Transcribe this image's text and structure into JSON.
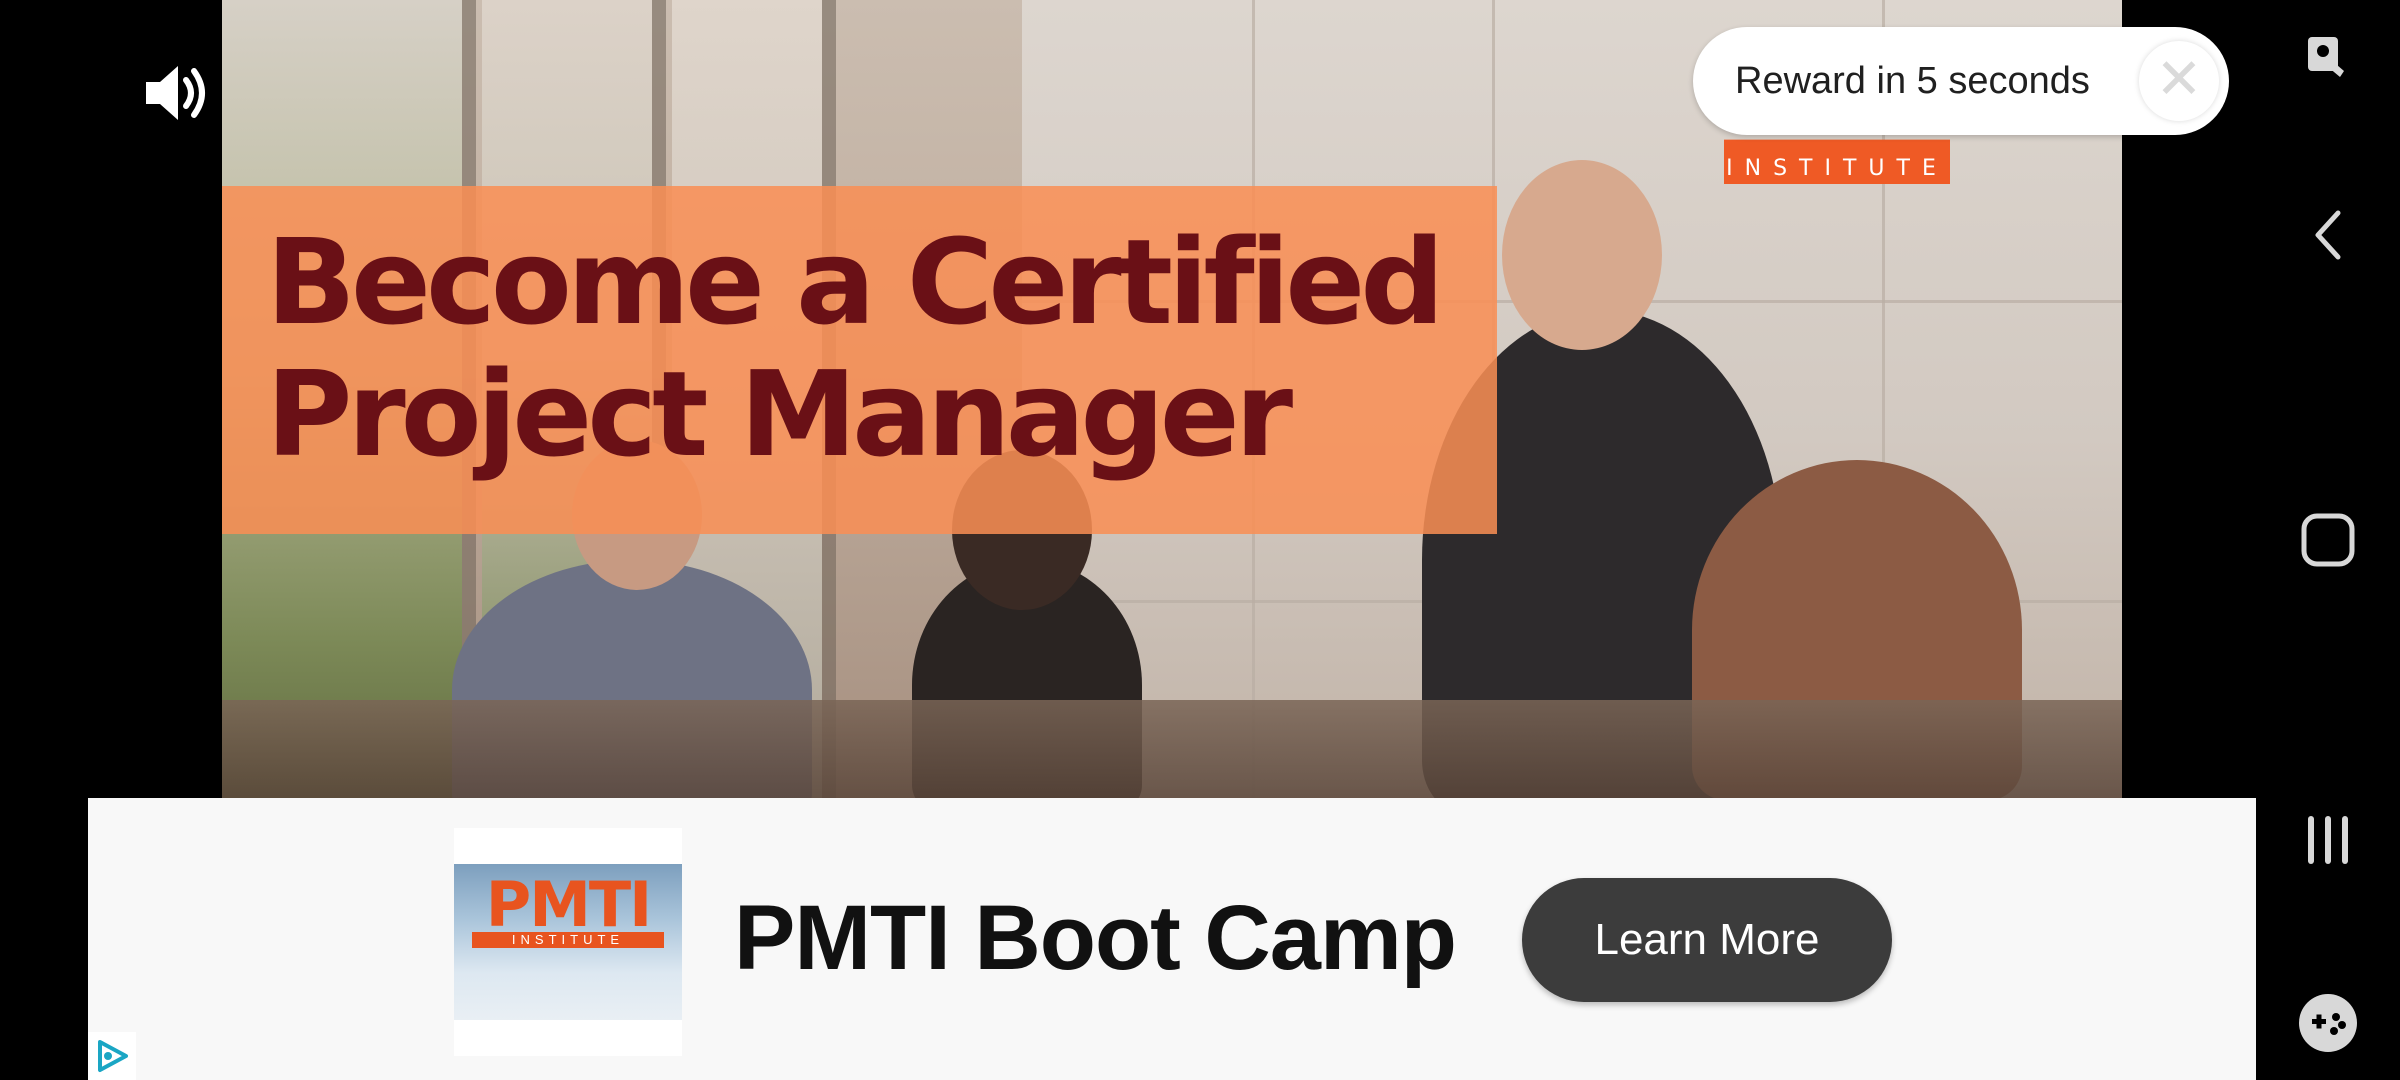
{
  "video": {
    "headline_line1": "Become a Certified",
    "headline_line2": "Project Manager",
    "brand_tagline": "INSTITUTE"
  },
  "reward": {
    "text": "Reward in 5 seconds",
    "close_glyph": "✕"
  },
  "banner": {
    "logo_text": "PMTI",
    "logo_subtext": "INSTITUTE",
    "title": "PMTI Boot Camp",
    "cta_label": "Learn More"
  },
  "icons": {
    "volume": "volume-icon",
    "screen_pin": "screen-pin-icon",
    "back": "back-icon",
    "home": "home-icon",
    "recents": "recents-icon",
    "game_tools": "game-controller-icon",
    "adchoices": "adchoices-icon"
  },
  "colors": {
    "headline_band": "#f98e54",
    "headline_text": "#6a1016",
    "cta_background": "#3c3c3c",
    "banner_background": "#f8f8f8",
    "brand_orange": "#ef5a25"
  }
}
